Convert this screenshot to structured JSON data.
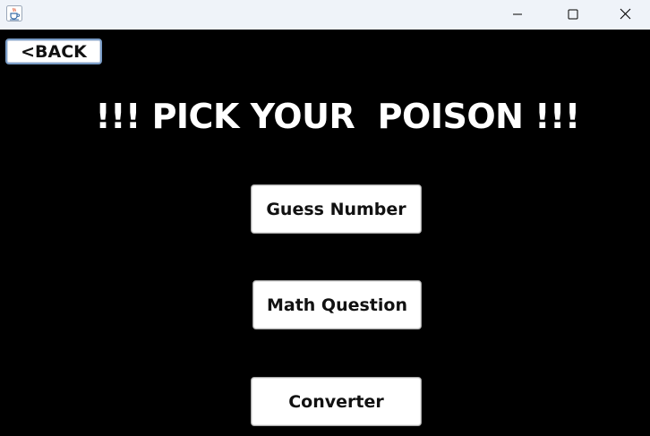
{
  "titlebar": {
    "app_icon": "java-cup-icon",
    "controls": {
      "minimize_icon": "minimize-icon",
      "maximize_icon": "maximize-icon",
      "close_icon": "close-icon"
    }
  },
  "main": {
    "back_label": "<BACK",
    "heading": "!!! PICK YOUR  POISON !!!",
    "buttons": [
      {
        "label": "Guess Number"
      },
      {
        "label": "Math Question"
      },
      {
        "label": "Converter"
      }
    ]
  },
  "colors": {
    "background": "#000000",
    "titlebar": "#eff3f9",
    "button_face": "#ffffff",
    "back_button_border": "#7a9cc6",
    "text_light": "#ffffff",
    "text_dark": "#111111"
  }
}
